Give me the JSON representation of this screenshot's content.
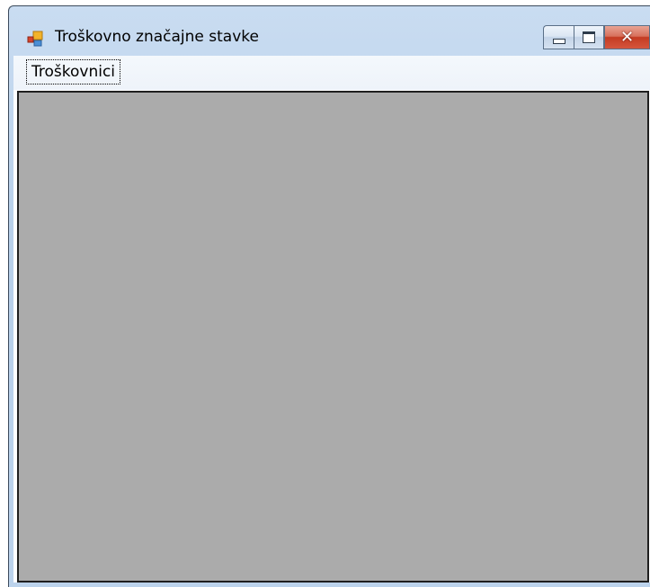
{
  "window": {
    "title": "Troškovno značajne stavke",
    "icon": "app-form-icon",
    "caption_buttons": {
      "minimize_icon": "minimize-icon",
      "maximize_icon": "maximize-icon",
      "close_icon": "close-icon",
      "close_glyph": "✕"
    }
  },
  "menu": {
    "items": [
      {
        "label": "Troškovnici"
      }
    ]
  },
  "colors": {
    "mdi_background": "#ababab",
    "close_button": "#c43b22",
    "frame": "#bcd3ec"
  }
}
